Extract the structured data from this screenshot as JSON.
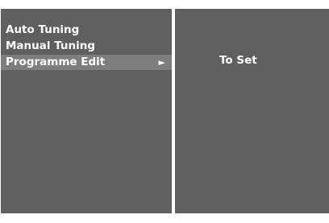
{
  "menu": {
    "items": [
      {
        "label": "Auto Tuning"
      },
      {
        "label": "Manual Tuning"
      },
      {
        "label": "Programme Edit",
        "arrow": "►"
      }
    ]
  },
  "submenu": {
    "items": [
      {
        "label": "To Set"
      }
    ]
  },
  "colors": {
    "panel": "#5f5f5f",
    "highlight": "#7e7e7e",
    "text": "#ffffff",
    "border": "#ffffff"
  }
}
